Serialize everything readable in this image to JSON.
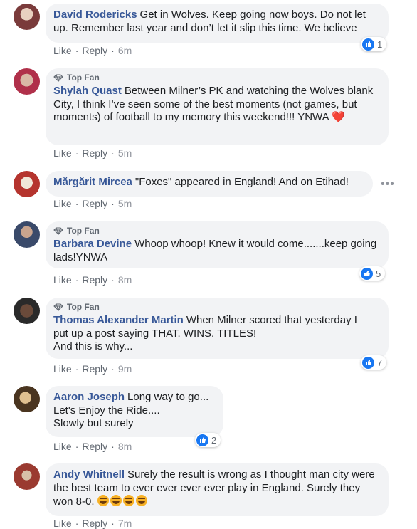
{
  "comments": [
    {
      "author": "David Rodericks",
      "text": "Get in Wolves. Keep going now boys. Do not let up. Remember last year and don’t let it slip this time. We believe",
      "like": "Like",
      "reply": "Reply",
      "time": "6m",
      "reactions": "1",
      "avatar_color": "#7a3b3b"
    },
    {
      "badge": "Top Fan",
      "author": "Shylah Quast",
      "text": "Between Milner’s PK and watching the Wolves blank City, I think I’ve seen some of the best moments (not games, but moments) of football to my memory this weekend!!! YNWA",
      "emoji": "❤️",
      "like": "Like",
      "reply": "Reply",
      "time": "5m",
      "avatar_color": "#c7a99b"
    },
    {
      "author": "Mărgărit Mircea",
      "text": "\"Foxes\" appeared in England! And on Etihad!",
      "like": "Like",
      "reply": "Reply",
      "time": "5m",
      "avatar_color": "#b5342e"
    },
    {
      "badge": "Top Fan",
      "author": "Barbara Devine",
      "text": "Whoop whoop! Knew it would come.......keep going lads!YNWA",
      "like": "Like",
      "reply": "Reply",
      "time": "8m",
      "reactions": "5",
      "avatar_color": "#3a4a6a"
    },
    {
      "badge": "Top Fan",
      "author": "Thomas Alexander Martin",
      "text_lines": [
        "When Milner scored that yesterday I",
        "put up a post saying THAT. WINS. TITLES!",
        "And this is why..."
      ],
      "like": "Like",
      "reply": "Reply",
      "time": "9m",
      "reactions": "7",
      "avatar_color": "#4a3a30"
    },
    {
      "author": "Aaron Joseph",
      "text_lines": [
        "Long way to go...",
        "Let's Enjoy the Ride....",
        "Slowly but surely"
      ],
      "like": "Like",
      "reply": "Reply",
      "time": "8m",
      "reactions": "2",
      "avatar_color": "#8b6a3b"
    },
    {
      "author": "Andy Whitnell",
      "text": "Surely the result is wrong as I thought man city were the best team to ever ever ever ever play in England. Surely they won 8-0.",
      "like": "Like",
      "reply": "Reply",
      "time": "7m",
      "avatar_color": "#9a3a30"
    }
  ],
  "colors": {
    "link": "#385898",
    "bubble": "#f2f3f5",
    "like_blue": "#1877f2"
  }
}
